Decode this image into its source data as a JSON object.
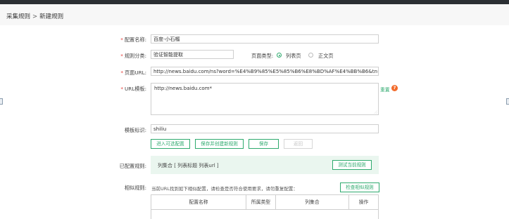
{
  "breadcrumb": {
    "parent": "采集规则",
    "separator": ">",
    "current": "新建规则"
  },
  "form": {
    "name": {
      "label": "配置名称:",
      "value": "百度-小石榴"
    },
    "category": {
      "label": "规则分类:",
      "value": "验证智能提取"
    },
    "page_type": {
      "label": "页面类型:",
      "options": [
        "列表页",
        "正文页"
      ],
      "selected": "列表页"
    },
    "page_url": {
      "label": "页面URL:",
      "value": "http://news.baidu.com/ns?word=%E4%B9%85%E5%85%B6%E8%BD%AF%E4%BB%B6&tn=news&f"
    },
    "url_template": {
      "label": "URL模板:",
      "value": "http://news.baidu.com*",
      "reset_label": "重置",
      "help_icon": "question-circle-icon"
    },
    "template_id": {
      "label": "模板标识:",
      "value": "shiliu"
    }
  },
  "buttons": {
    "visual_config": "进入可选配置",
    "save_and_new": "保存并创建新规则",
    "save": "保存",
    "back": "返回"
  },
  "configured_rules": {
    "label": "已配置规则:",
    "text": "列集合 [ 列表标题  列表url ]",
    "test_button": "测试当前规则"
  },
  "similar_rules": {
    "label": "相似规则:",
    "hint": "当前URL找到如下相似配置，请检查是否符合使用要求，请勿重复配置：",
    "check_button": "检查相似规则",
    "columns": [
      "配置名称",
      "所属类型",
      "列集合",
      "操作"
    ]
  },
  "colors": {
    "accent": "#2eaa6e",
    "required": "#e53935",
    "help": "#f26b2c"
  }
}
